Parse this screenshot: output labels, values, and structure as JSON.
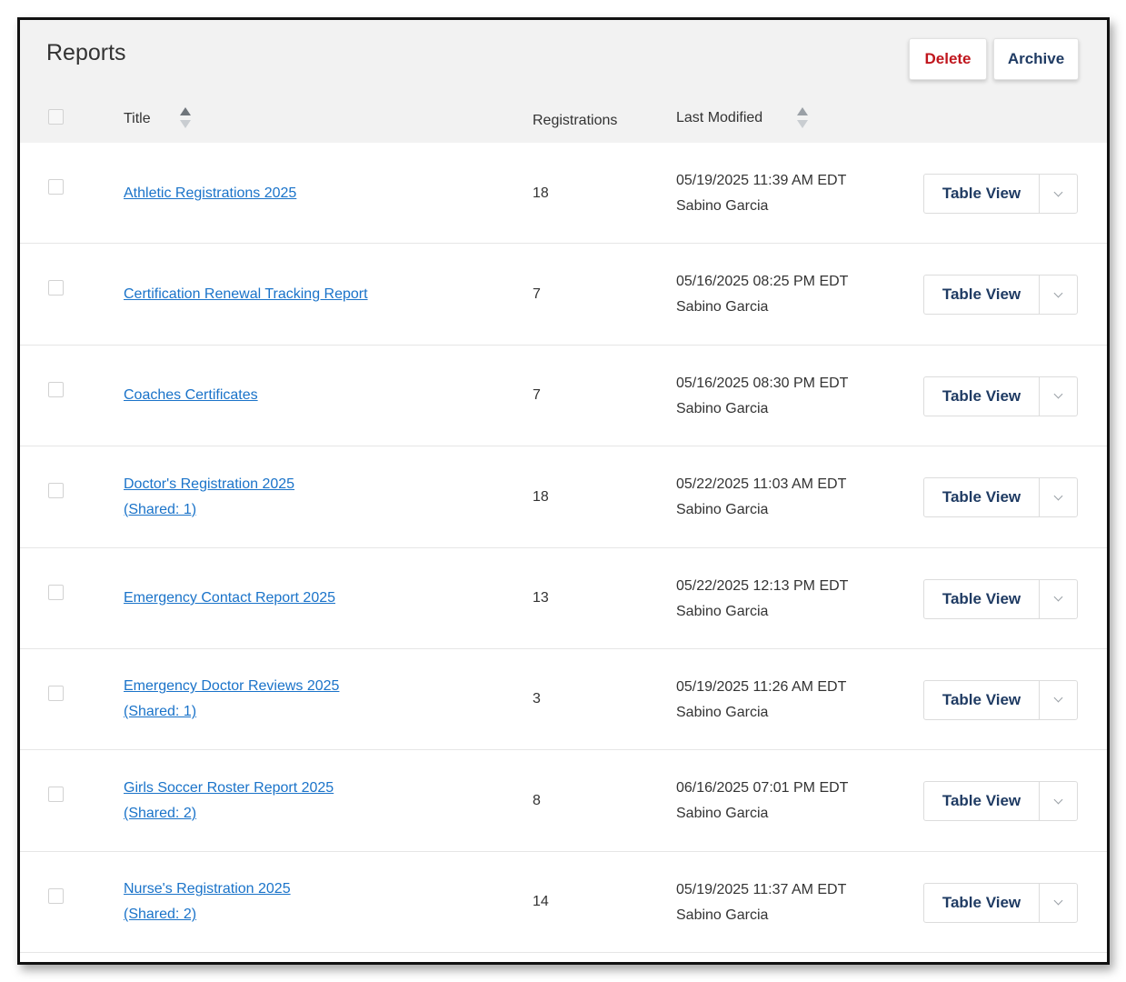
{
  "header": {
    "title": "Reports",
    "delete_label": "Delete",
    "archive_label": "Archive"
  },
  "columns": {
    "title": "Title",
    "registrations": "Registrations",
    "last_modified": "Last Modified"
  },
  "colors": {
    "link": "#1a73c9",
    "delete": "#c0161d",
    "accent": "#1f3b63",
    "header_bg": "#f2f2f2"
  },
  "action_label": "Table View",
  "rows": [
    {
      "title": "Athletic Registrations 2025",
      "shared": "",
      "registrations": "18",
      "date": "05/19/2025 11:39 AM EDT",
      "user": "Sabino Garcia"
    },
    {
      "title": "Certification Renewal Tracking Report",
      "shared": "",
      "registrations": "7",
      "date": "05/16/2025 08:25 PM EDT",
      "user": "Sabino Garcia"
    },
    {
      "title": "Coaches Certificates",
      "shared": "",
      "registrations": "7",
      "date": "05/16/2025 08:30 PM EDT",
      "user": "Sabino Garcia"
    },
    {
      "title": "Doctor's Registration 2025",
      "shared": "(Shared: 1)",
      "registrations": "18",
      "date": "05/22/2025 11:03 AM EDT",
      "user": "Sabino Garcia"
    },
    {
      "title": "Emergency Contact Report 2025",
      "shared": "",
      "registrations": "13",
      "date": "05/22/2025 12:13 PM EDT",
      "user": "Sabino Garcia"
    },
    {
      "title": "Emergency Doctor Reviews 2025",
      "shared": "(Shared: 1)",
      "registrations": "3",
      "date": "05/19/2025 11:26 AM EDT",
      "user": "Sabino Garcia"
    },
    {
      "title": "Girls Soccer Roster Report 2025",
      "shared": "(Shared: 2)",
      "registrations": "8",
      "date": "06/16/2025 07:01 PM EDT",
      "user": "Sabino Garcia"
    },
    {
      "title": "Nurse's Registration 2025",
      "shared": "(Shared: 2)",
      "registrations": "14",
      "date": "05/19/2025 11:37 AM EDT",
      "user": "Sabino Garcia"
    }
  ]
}
